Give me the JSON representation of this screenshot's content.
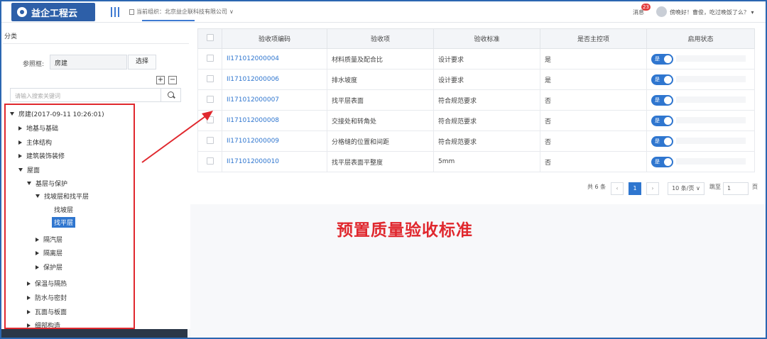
{
  "header": {
    "logo_text": "益企工程云",
    "org_label": "当前组织：北京益企联科技有限公司",
    "org_caret": "∨",
    "message_label": "消息",
    "message_count": "23",
    "greeting": "傍晚好！曹俊，吃过晚饭了么？",
    "greeting_caret": "▾"
  },
  "sidebar": {
    "title": "分类",
    "ref_label": "参照框:",
    "ref_value": "房建",
    "select_label": "选择",
    "expand_all": "+",
    "collapse_all": "−",
    "search_placeholder": "请输入搜索关键词",
    "tree": {
      "root": "房建(2017-09-11 10:26:01)",
      "n1": "地基与基础",
      "n2": "主体结构",
      "n3": "建筑装饰装修",
      "n4": "屋面",
      "n4_1": "基层与保护",
      "n4_1_1": "找坡层和找平层",
      "n4_1_1_1": "找坡层",
      "n4_1_1_2": "找平层",
      "n4_1_2": "隔汽层",
      "n4_1_3": "隔离层",
      "n4_1_4": "保护层",
      "n4_2": "保温与隔热",
      "n4_3": "防水与密封",
      "n4_4": "瓦面与板面",
      "n4_5": "细部构造"
    }
  },
  "table": {
    "headers": {
      "code": "验收项编码",
      "item": "验收项",
      "standard": "验收标准",
      "main_control": "是否主控项",
      "status": "启用状态"
    },
    "rows": [
      {
        "code": "II171012000004",
        "item": "材料质量及配合比",
        "standard": "设计要求",
        "main_control": "是",
        "status": "是"
      },
      {
        "code": "II171012000006",
        "item": "排水坡度",
        "standard": "设计要求",
        "main_control": "是",
        "status": "是"
      },
      {
        "code": "II171012000007",
        "item": "找平层表面",
        "standard": "符合规范要求",
        "main_control": "否",
        "status": "是"
      },
      {
        "code": "II171012000008",
        "item": "交接处和转角处",
        "standard": "符合规范要求",
        "main_control": "否",
        "status": "是"
      },
      {
        "code": "II171012000009",
        "item": "分格缝的位置和间距",
        "standard": "符合规范要求",
        "main_control": "否",
        "status": "是"
      },
      {
        "code": "II171012000010",
        "item": "找平层表面平整度",
        "standard": "5mm",
        "main_control": "否",
        "status": "是"
      }
    ]
  },
  "pagination": {
    "total": "共 6 条",
    "prev": "‹",
    "current_page": "1",
    "next": "›",
    "page_size": "10 条/页 ∨",
    "goto_label": "跳至",
    "goto_value": "1",
    "page_unit": "页"
  },
  "annotation": {
    "text": "预置质量验收标准",
    "color": "#e0282e"
  },
  "colors": {
    "accent": "#2f76cf",
    "annotation_red": "#e0282e"
  }
}
